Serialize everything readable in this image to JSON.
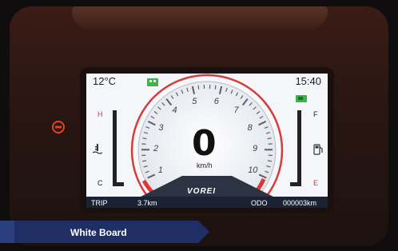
{
  "dashboard": {
    "temperature": "12°C",
    "clock": "15:40",
    "speed": "0",
    "speed_unit": "km/h",
    "brand": "VOREI",
    "tachometer_ticks": [
      "1",
      "2",
      "3",
      "4",
      "5",
      "6",
      "7",
      "8",
      "9",
      "10"
    ],
    "temp_gauge": {
      "high": "H",
      "low": "C"
    },
    "fuel_gauge": {
      "full": "F",
      "empty": "E"
    },
    "trip_label": "TRIP",
    "trip_value": "3.7km",
    "odo_label": "ODO",
    "odo_value": "000003km"
  },
  "caption": {
    "text": "White Board"
  },
  "colors": {
    "screen_bg": "#f4f6fa",
    "accent_red": "#d83a3a",
    "indicator_green": "#3bb44a",
    "caption_bg": "#1f2f66",
    "bottom_bar": "#1b2233"
  },
  "icons": {
    "warning_light": "engine-warning-icon",
    "battery": "battery-icon",
    "camera": "camera-icon",
    "coolant": "coolant-temperature-icon",
    "fuel": "fuel-pump-icon"
  }
}
